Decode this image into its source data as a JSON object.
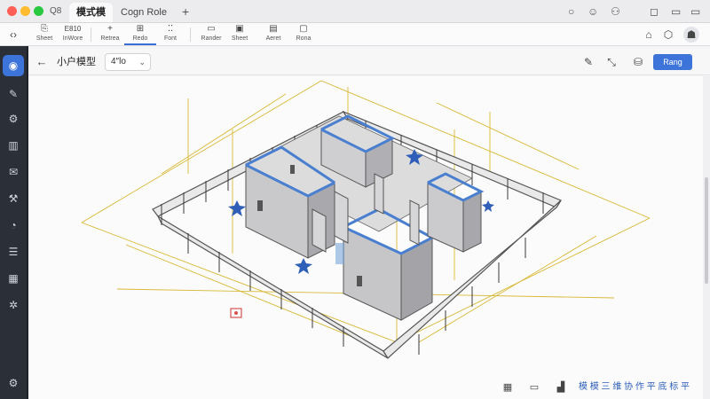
{
  "window": {
    "tabs": [
      "模式模",
      "Cogn  Role"
    ],
    "new_tab": "+",
    "grid_icon_label": "Q8"
  },
  "toolbar": {
    "back_icon": "chevron-left-right",
    "tools": [
      {
        "label": "Sheet",
        "icon": "doc"
      },
      {
        "label": "InWore",
        "icon": "E810"
      },
      {
        "label": "Retrea",
        "icon": "+"
      },
      {
        "label": "Redo",
        "icon": "plan"
      },
      {
        "label": "Font",
        "icon": "grid"
      },
      {
        "label": "Rander",
        "icon": "render"
      },
      {
        "label": "Sheet",
        "icon": "sheet"
      },
      {
        "label": "Aeret",
        "icon": "doc"
      },
      {
        "label": "Rona",
        "icon": "doc"
      }
    ],
    "top_number": "E810"
  },
  "subbar": {
    "breadcrumb": "小户模型",
    "dropdown_value": "4″lo",
    "primary_button": "Rang"
  },
  "sidebar": {
    "items": [
      "home",
      "layers",
      "settings",
      "docs",
      "mail",
      "tools",
      "chart",
      "list",
      "calendar",
      "gear",
      "settings-bottom"
    ]
  },
  "bottom": {
    "label": "模 模 三 维 协 作 平 底 标 平"
  },
  "colors": {
    "accent": "#3d74d9",
    "wall_cap": "#4a7fd0",
    "dimension": "#d9b836",
    "sidebar": "#2a2f38"
  }
}
